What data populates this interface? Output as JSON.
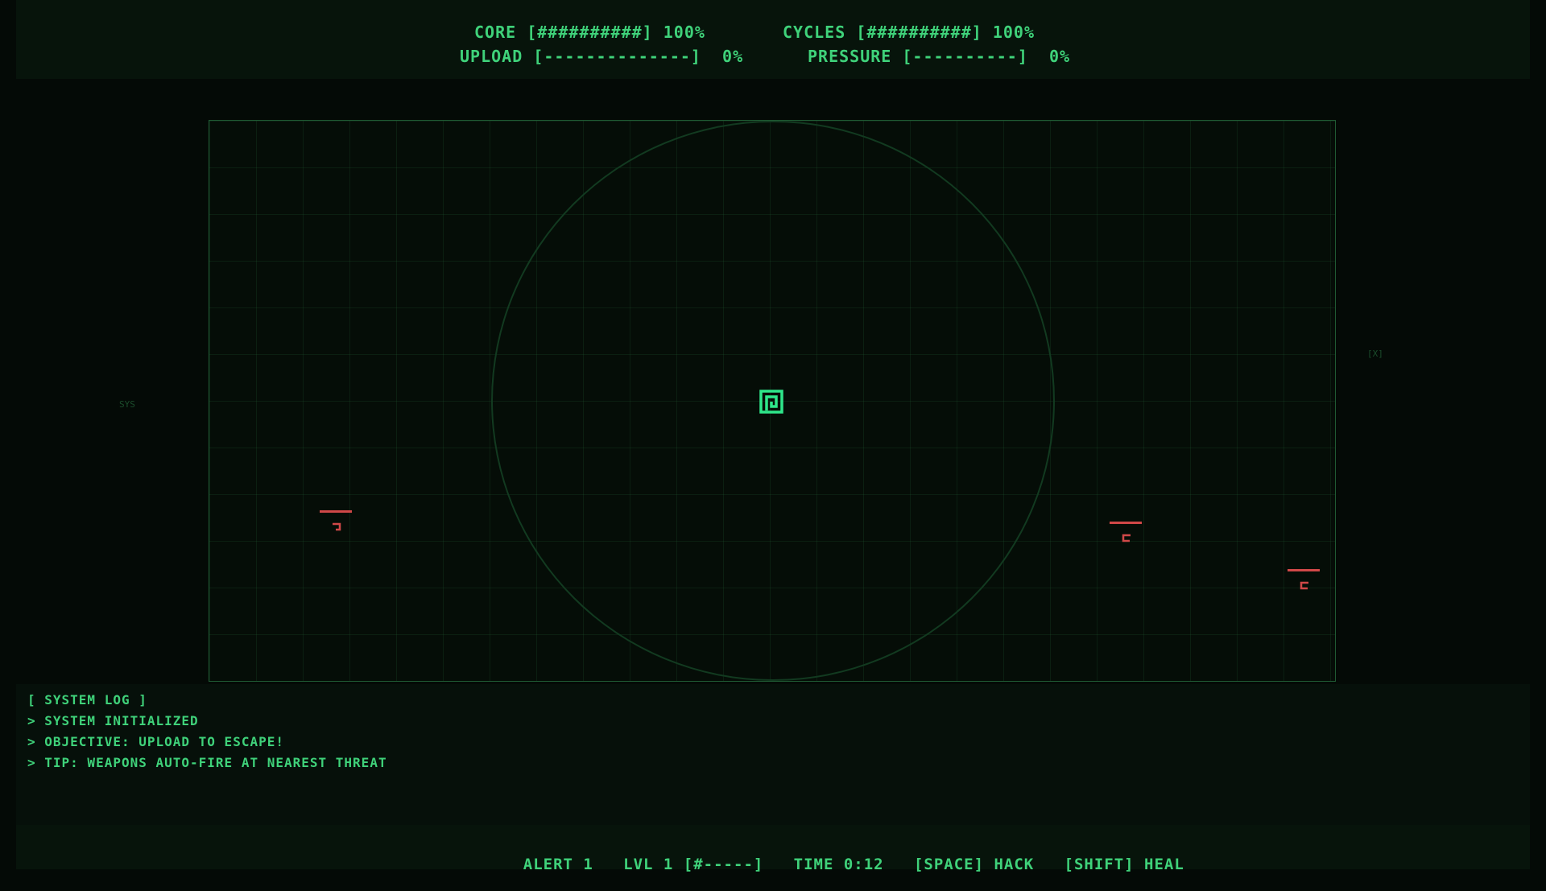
{
  "hud": {
    "core": "CORE [##########] 100%",
    "cycles": "CYCLES [##########] 100%",
    "upload": "UPLOAD [--------------]  0%",
    "pressure": "PRESSURE [----------]  0%"
  },
  "arena": {
    "player_level": 1,
    "enemies": [
      {
        "id": "enemy-left",
        "health": 1.0
      },
      {
        "id": "enemy-right-1",
        "health": 1.0
      },
      {
        "id": "enemy-right-2",
        "health": 1.0
      }
    ]
  },
  "system_log": {
    "title": "[ SYSTEM LOG ]",
    "lines": [
      "> SYSTEM INITIALIZED",
      "> OBJECTIVE: UPLOAD TO ESCAPE!",
      "> TIP: WEAPONS AUTO-FIRE AT NEAREST THREAT"
    ]
  },
  "status_bar": {
    "alert": "ALERT 1",
    "level": "LVL 1 [#-----]",
    "time": "TIME 0:12",
    "hack": "[SPACE] HACK",
    "heal": "[SHIFT] HEAL"
  },
  "ambient": {
    "sys": "SYS",
    "bracket": "[X]"
  },
  "colors": {
    "primary": "#3fd27a",
    "enemy": "#d04848",
    "player": "#2ee68a",
    "arena_border": "#1f5a33"
  }
}
